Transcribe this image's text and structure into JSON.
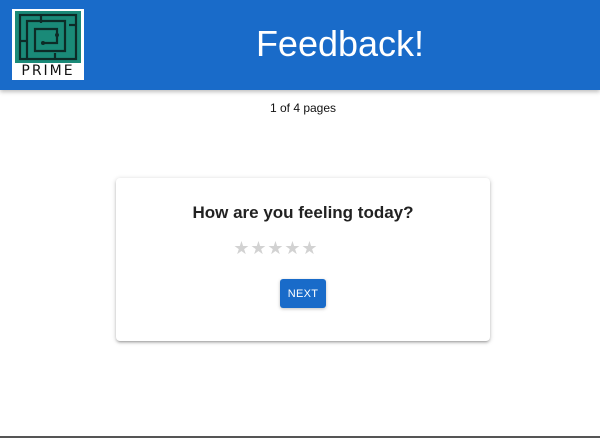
{
  "header": {
    "title": "Feedback!",
    "logo": {
      "text": "PRIME",
      "icon": "prime-maze-logo",
      "color": "#1a8a78"
    },
    "background_color": "#196bc9"
  },
  "pagination": {
    "text": "1 of 4 pages"
  },
  "card": {
    "question": "How are you feeling today?",
    "rating": {
      "max": 5,
      "value": 0,
      "icon": "star-icon",
      "empty_color": "#d2d2d2"
    },
    "next_label": "NEXT"
  }
}
